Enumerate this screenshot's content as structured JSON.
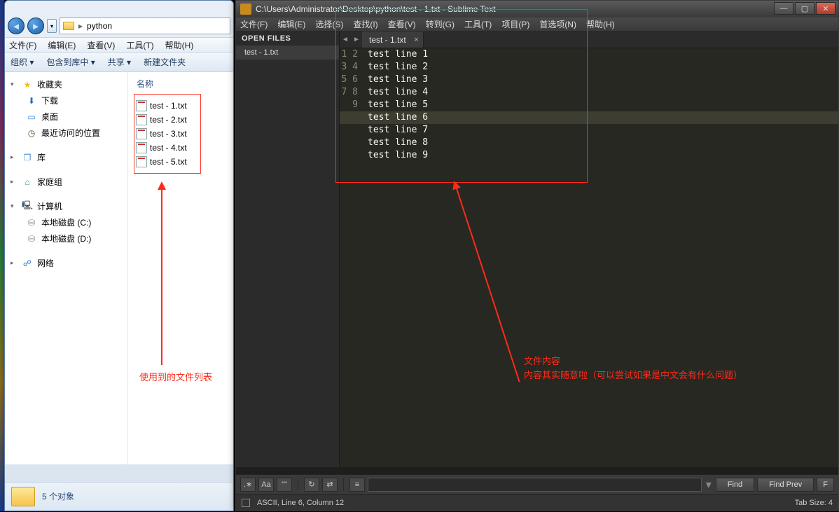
{
  "explorer": {
    "address_path": "python",
    "menu": [
      "文件(F)",
      "编辑(E)",
      "查看(V)",
      "工具(T)",
      "帮助(H)"
    ],
    "toolbar": [
      "组织 ▾",
      "包含到库中 ▾",
      "共享 ▾",
      "新建文件夹"
    ],
    "sidebar": {
      "favorites": {
        "label": "收藏夹",
        "items": [
          "下载",
          "桌面",
          "最近访问的位置"
        ]
      },
      "libraries": {
        "label": "库"
      },
      "homegroup": {
        "label": "家庭组"
      },
      "computer": {
        "label": "计算机",
        "drives": [
          "本地磁盘 (C:)",
          "本地磁盘 (D:)"
        ]
      },
      "network": {
        "label": "网络"
      }
    },
    "column_header": "名称",
    "files": [
      "test - 1.txt",
      "test - 2.txt",
      "test - 3.txt",
      "test - 4.txt",
      "test - 5.txt"
    ],
    "status": "5 个对象",
    "annotation": "使用到的文件列表"
  },
  "sublime": {
    "title": "C:\\Users\\Administrator\\Desktop\\python\\test - 1.txt - Sublime Text",
    "menu": [
      "文件(F)",
      "编辑(E)",
      "选择(S)",
      "查找(I)",
      "查看(V)",
      "转到(G)",
      "工具(T)",
      "项目(P)",
      "首选项(N)",
      "帮助(H)"
    ],
    "open_files_label": "OPEN FILES",
    "open_files": [
      "test - 1.txt"
    ],
    "tab": "test - 1.txt",
    "lines": [
      "test line 1",
      "test line 2",
      "test line 3",
      "test line 4",
      "test line 5",
      "test line 6",
      "test line 7",
      "test line 8",
      "test line 9"
    ],
    "highlighted_line": 6,
    "find": {
      "find_label": "Find",
      "find_prev_label": "Find Prev",
      "find_all_label": "F"
    },
    "status_left": "ASCII, Line 6, Column 12",
    "status_right": "Tab Size: 4",
    "annotation_line1": "文件内容",
    "annotation_line2": "内容其实随意啦（可以尝试如果是中文会有什么问题）"
  }
}
